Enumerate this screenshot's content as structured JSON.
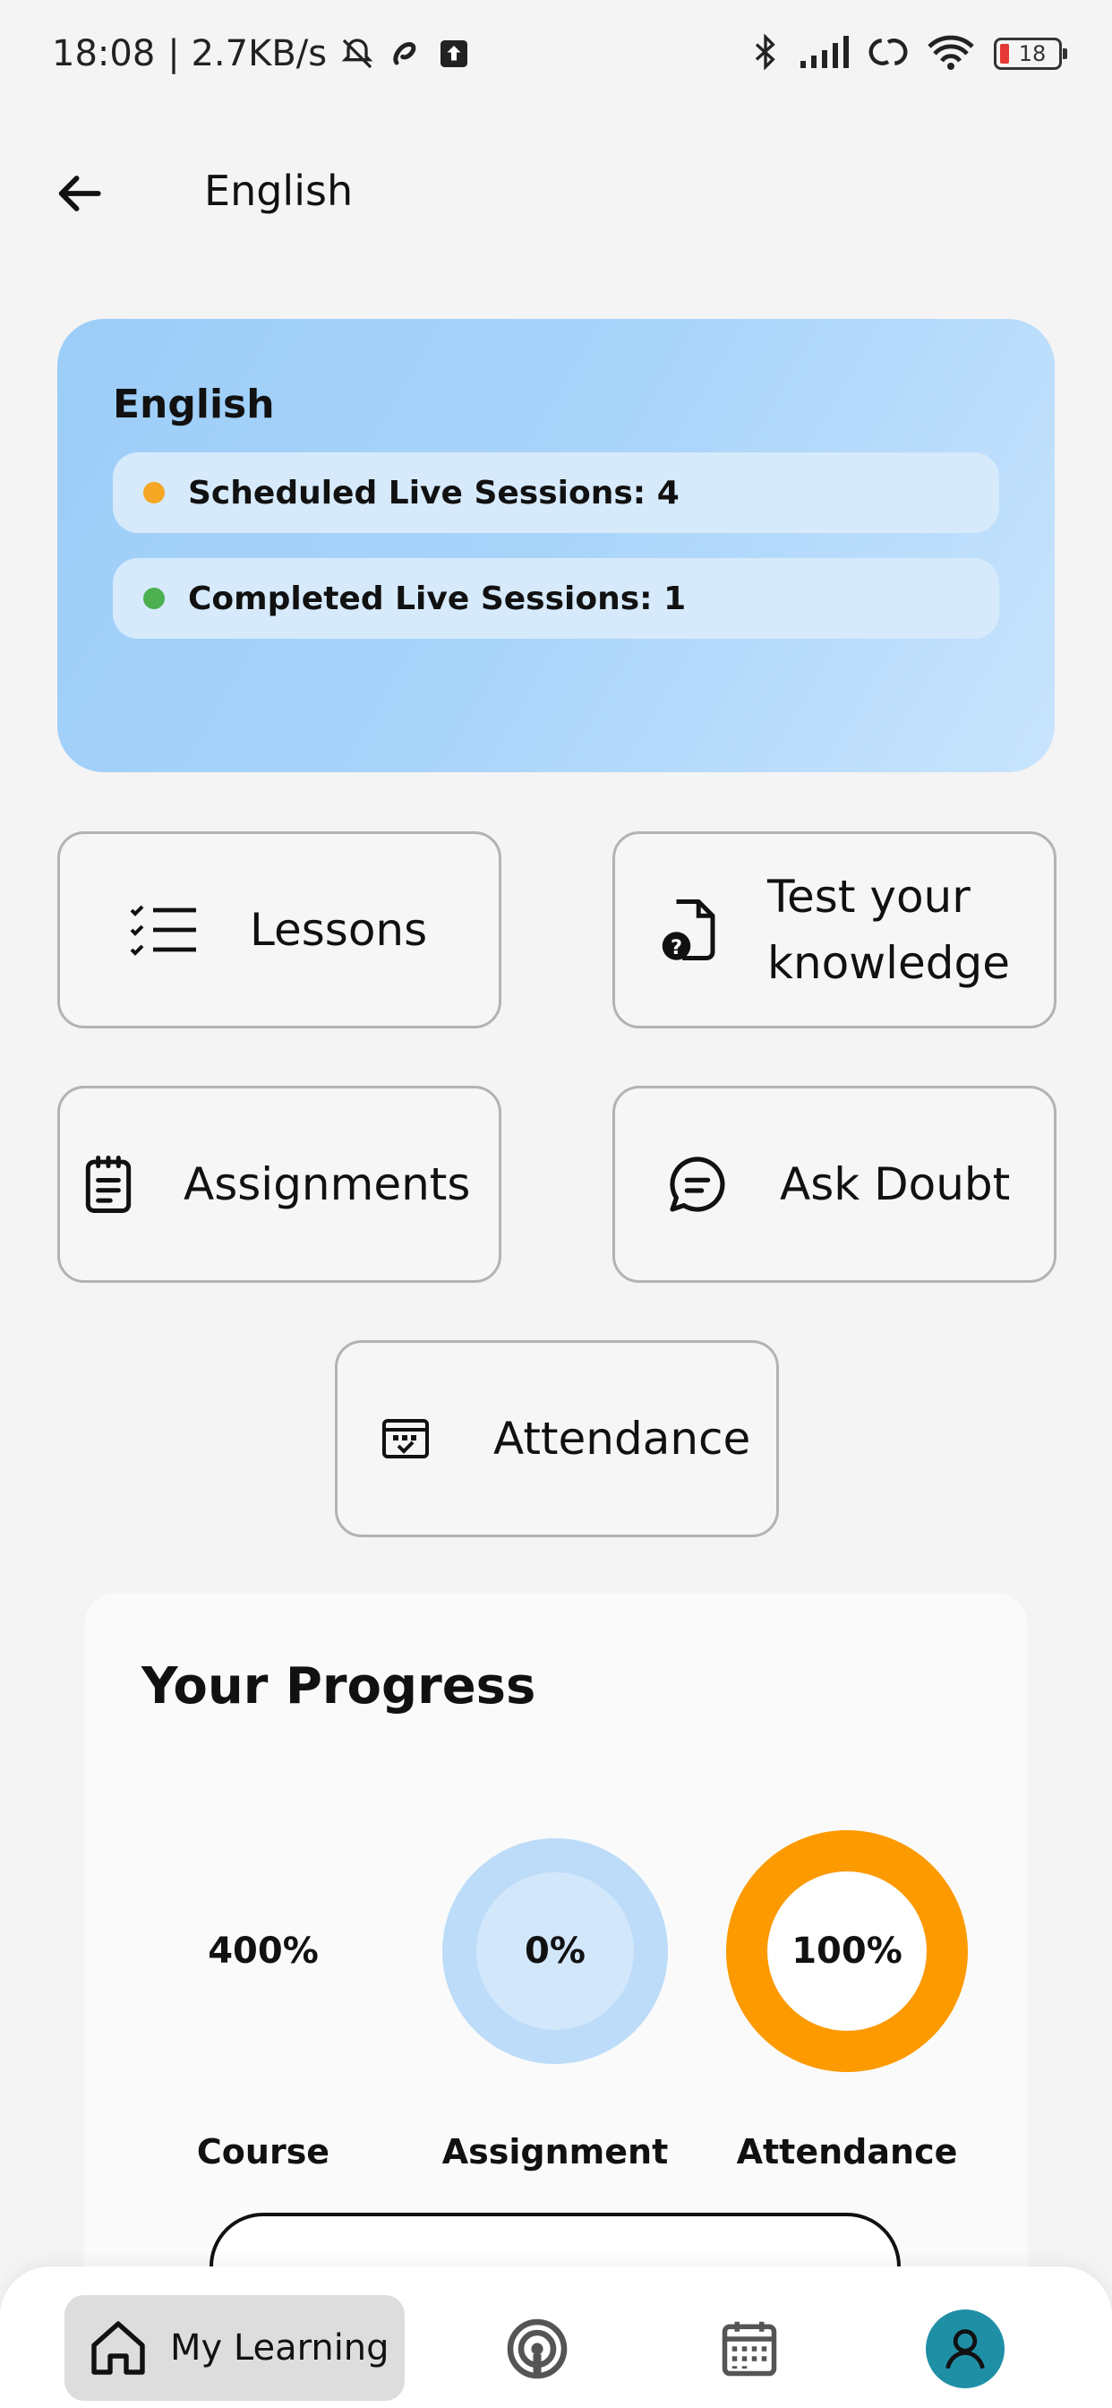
{
  "status_bar": {
    "time": "18:08",
    "speed": "| 2.7KB/s",
    "battery": "18",
    "icons": [
      "bell-off-icon",
      "airtel-icon",
      "upload-icon",
      "bluetooth-icon",
      "signal-icon",
      "hotspot-icon",
      "wifi-icon",
      "battery-icon"
    ]
  },
  "app_bar": {
    "back_icon": "arrow-left-icon",
    "title": "English"
  },
  "subject_card": {
    "name": "English",
    "scheduled": "Scheduled Live Sessions: 4",
    "completed": "Completed Live Sessions: 1",
    "scheduled_color": "#f5a623",
    "completed_color": "#4caf50"
  },
  "actions": {
    "lessons": "Lessons",
    "test_line1": "Test your",
    "test_line2": "knowledge",
    "assignments": "Assignments",
    "ask_doubt": "Ask Doubt",
    "attendance": "Attendance"
  },
  "progress": {
    "title": "Your Progress",
    "course": {
      "value": "400%",
      "label": "Course",
      "fraction": 4.0
    },
    "assignment": {
      "value": "0%",
      "label": "Assignment",
      "fraction": 0.0
    },
    "attendance": {
      "value": "100%",
      "label": "Attendance",
      "fraction": 1.0
    },
    "colors": {
      "track": "#bcdcf9",
      "fill": "#fd9a00",
      "inner": "#d3e7fb"
    }
  },
  "bottom_nav": {
    "my_learning": "My Learning",
    "icons": [
      "home-icon",
      "live-icon",
      "calendar-icon",
      "profile-icon"
    ]
  }
}
